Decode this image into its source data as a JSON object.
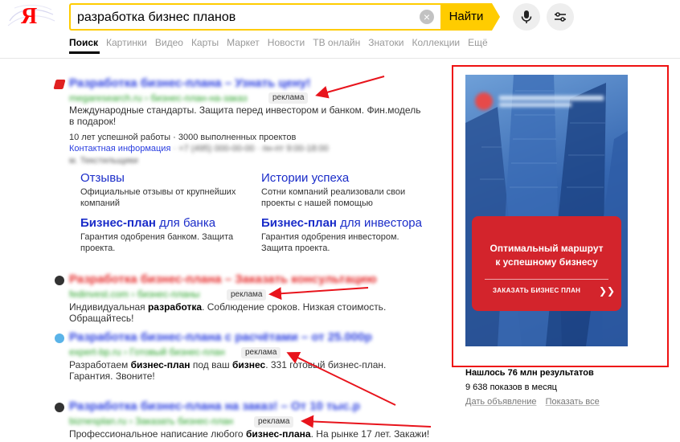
{
  "search": {
    "query": "разработка бизнес планов",
    "button": "Найти",
    "clear": "×"
  },
  "logo": {
    "letter": "Я"
  },
  "tabs": [
    {
      "label": "Поиск",
      "active": true
    },
    {
      "label": "Картинки"
    },
    {
      "label": "Видео"
    },
    {
      "label": "Карты"
    },
    {
      "label": "Маркет"
    },
    {
      "label": "Новости"
    },
    {
      "label": "ТВ онлайн"
    },
    {
      "label": "Знатоки"
    },
    {
      "label": "Коллекции"
    },
    {
      "label": "Ещё"
    }
  ],
  "results": [
    {
      "title": "Разработка бизнес-плана – Узнать цену!",
      "url": "megaresearch.ru › бизнес-план-на-заказ",
      "badge": "реклама",
      "snippet": "Международные стандарты. Защита перед инвестором и банком. Фин.модель в подарок!",
      "extra": "10 лет успешной работы  ·  3000 выполненных проектов",
      "contact": "Контактная информация",
      "contact_rest": "· +7 (495) 000-00-00 · пн-пт 9:00-18:00",
      "address": "м. Текстильщики",
      "sitelinks": [
        {
          "title": "Отзывы",
          "desc": "Официальные отзывы от крупнейших компаний"
        },
        {
          "title": "Истории успеха",
          "desc": "Сотни компаний реализовали свои проекты с нашей помощью"
        },
        {
          "title_bold": "Бизнес-план",
          "title_rest": " для банка",
          "desc": "Гарантия одобрения банком. Защита проекта."
        },
        {
          "title_bold": "Бизнес-план",
          "title_rest": " для инвестора",
          "desc": "Гарантия одобрения инвестором. Защита проекта."
        }
      ]
    },
    {
      "title": "Разработка бизнес-плана – Заказать консультацию",
      "url": "fedinvest.com › бизнес-планы",
      "badge": "реклама",
      "snippet_pre": "Индивидуальная ",
      "snippet_bold": "разработка",
      "snippet_post": ". Соблюдение сроков. Низкая стоимость. Обращайтесь!"
    },
    {
      "title": "Разработка бизнес-плана с расчётами – от 25.000р",
      "url": "expert-bp.ru › Готовый бизнес-план",
      "badge": "реклама",
      "snippet_pre": "Разработаем ",
      "snippet_bold1": "бизнес-план",
      "snippet_mid": " под ваш ",
      "snippet_bold2": "бизнес",
      "snippet_post": ". 331 готовый бизнес-план. Гарантия. Звоните!"
    },
    {
      "title": "Разработка бизнес-плана на заказ! – От 10 тыс.р",
      "url": "biznesplan.ru › Заказать бизнес-план",
      "badge": "реклама",
      "snippet_pre": "Профессиональное написание любого ",
      "snippet_bold": "бизнес-плана",
      "snippet_post": ". На рынке 17 лет. Закажи!"
    }
  ],
  "banner": {
    "title_line1": "Оптимальный маршрут",
    "title_line2": "к успешному бизнесу",
    "button": "ЗАКАЗАТЬ БИЗНЕС ПЛАН",
    "chevron": "❯❯"
  },
  "stats": {
    "found": "Нашлось 76 млн результатов",
    "shows": "9 638 показов в месяц",
    "link1": "Дать объявление",
    "link2": "Показать все"
  },
  "colors": {
    "accent": "#ffcc00",
    "highlight_frame": "#ee1111",
    "link": "#2a3ee0",
    "url_green": "#26a126"
  }
}
